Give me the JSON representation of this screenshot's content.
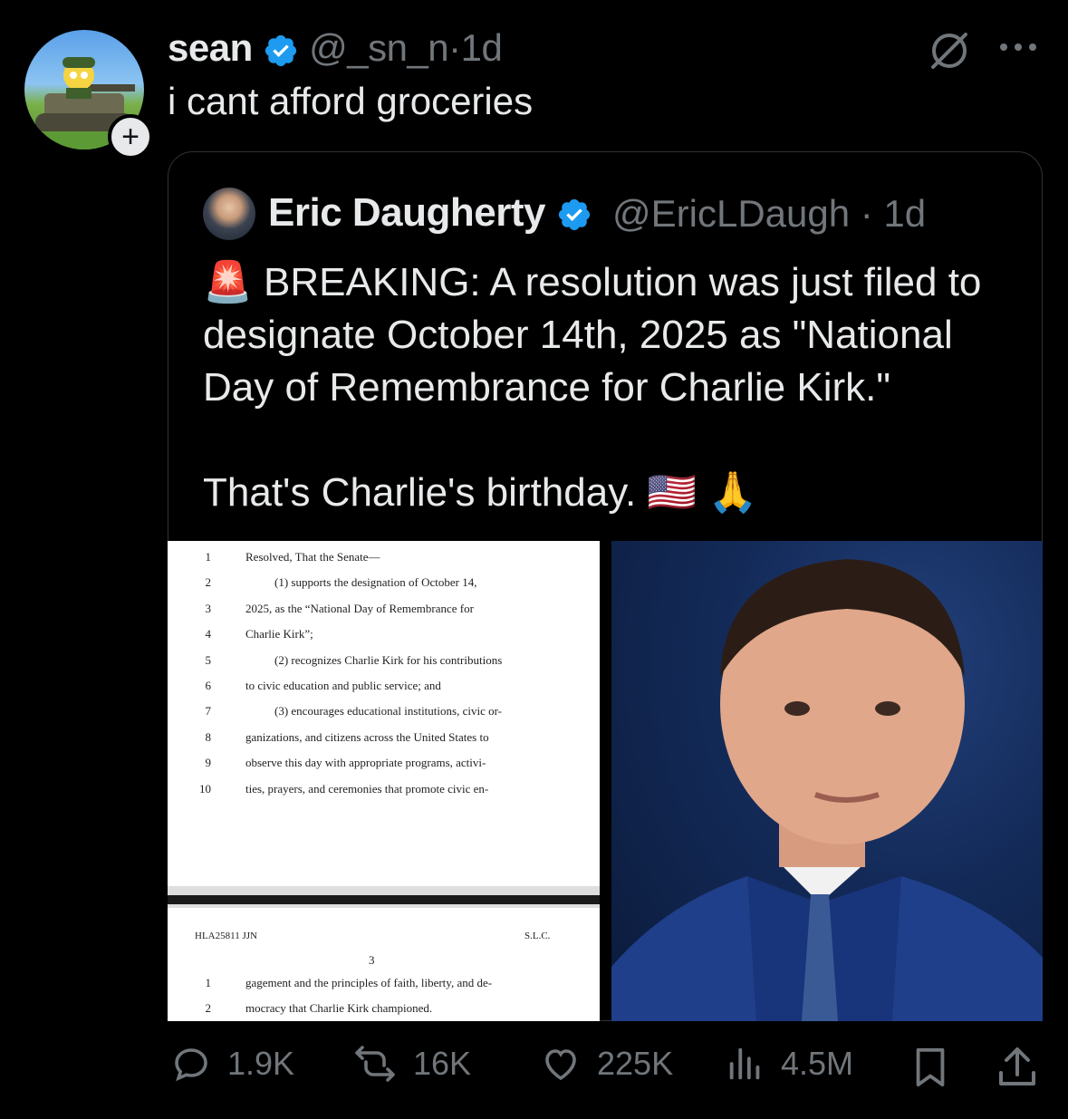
{
  "tweet": {
    "author_name": "sean",
    "author_handle": "@_sn_n",
    "time": "1d",
    "text": "i cant afford groceries",
    "follow_symbol": "+"
  },
  "quoted": {
    "author_name": "Eric Daugherty",
    "author_handle": "@EricLDaugh",
    "time": "1d",
    "text_lines": [
      "BREAKING: A resolution was just filed to",
      "designate October 14th, 2025 as \"National",
      "Day of Remembrance for Charlie Kirk.\"",
      "",
      "That's Charlie's birthday."
    ],
    "emoji_alert": "🚨",
    "emoji_flag": "🇺🇸",
    "emoji_pray": "🙏"
  },
  "document": {
    "lines": [
      {
        "num": "1",
        "text": "Resolved, That the Senate—"
      },
      {
        "num": "2",
        "text": "(1) supports the designation of October 14,"
      },
      {
        "num": "3",
        "text": "2025, as the “National Day of Remembrance for"
      },
      {
        "num": "4",
        "text": "Charlie Kirk”;"
      },
      {
        "num": "5",
        "text": "(2) recognizes Charlie Kirk for his contributions"
      },
      {
        "num": "6",
        "text": "to civic education and public service; and"
      },
      {
        "num": "7",
        "text": "(3) encourages educational institutions, civic or-"
      },
      {
        "num": "8",
        "text": "ganizations, and citizens across the United States to"
      },
      {
        "num": "9",
        "text": "observe this day with appropriate programs, activi-"
      },
      {
        "num": "10",
        "text": "ties, prayers, and ceremonies that promote civic en-"
      }
    ],
    "page2_header_left": "HLA25811 JJN",
    "page2_header_right": "S.L.C.",
    "page2_number": "3",
    "page2_lines": [
      {
        "num": "1",
        "text": "gagement and the principles of faith, liberty, and de-"
      },
      {
        "num": "2",
        "text": "mocracy that Charlie Kirk championed."
      }
    ]
  },
  "actions": {
    "replies": "1.9K",
    "reposts": "16K",
    "likes": "225K",
    "views": "4.5M"
  },
  "colors": {
    "background": "#000000",
    "text": "#e7e9ea",
    "muted": "#71767b",
    "verified": "#1d9bf0",
    "border": "#2f3336"
  }
}
